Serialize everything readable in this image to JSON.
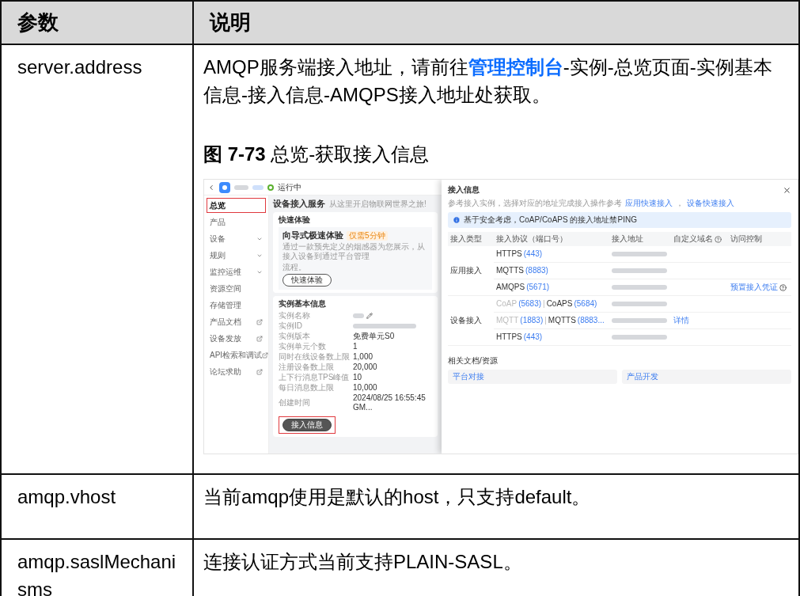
{
  "table": {
    "columns": [
      "参数",
      "说明"
    ],
    "rows": [
      {
        "param": "server.address",
        "description": {
          "before": "AMQP服务端接入地址，请前往",
          "link": "管理控制台",
          "after": "-实例-总览页面-实例基本信息-接入信息-AMQPS接入地址处获取。"
        },
        "figure": {
          "caption": "**图 7-73** 总览-获取接入信息",
          "screenshot": {
            "status": "运行中",
            "sidebar": [
              {
                "label": "总览",
                "kind": "plain",
                "selected": true
              },
              {
                "label": "产品",
                "kind": "plain",
                "selected": false
              },
              {
                "label": "设备",
                "kind": "expandable",
                "selected": false
              },
              {
                "label": "规则",
                "kind": "expandable",
                "selected": false
              },
              {
                "label": "监控运维",
                "kind": "expandable",
                "selected": false
              },
              {
                "label": "资源空间",
                "kind": "plain",
                "selected": false
              },
              {
                "label": "存储管理",
                "kind": "plain",
                "selected": false
              },
              {
                "label": "产品文档",
                "kind": "external",
                "selected": false
              },
              {
                "label": "设备发放",
                "kind": "external",
                "selected": false
              },
              {
                "label": "API检索和调试",
                "kind": "external",
                "selected": false
              },
              {
                "label": "论坛求助",
                "kind": "external",
                "selected": false
              }
            ],
            "service": {
              "title": "设备接入服务",
              "subtitle": "从这里开启物联网世界之旅!"
            },
            "quick": {
              "title": "快速体验",
              "heading": "向导式极速体验",
              "badge": "仅需5分钟",
              "description": "通过一款预先定义的烟感器为您展示，从接入设备到通过平台管理",
              "description_end": "流程。",
              "button": "快速体验"
            },
            "instance": {
              "title": "实例基本信息",
              "fields": [
                {
                  "label": "实例名称",
                  "editable": true
                },
                {
                  "label": "实例ID"
                },
                {
                  "label": "实例版本",
                  "value": "免费单元S0"
                },
                {
                  "label": "实例单元个数",
                  "value": "1"
                },
                {
                  "label": "同时在线设备数上限",
                  "value": "1,000"
                },
                {
                  "label": "注册设备数上限",
                  "value": "20,000"
                },
                {
                  "label": "上下行消息TPS峰值",
                  "value": "10"
                },
                {
                  "label": "每日消息数上限",
                  "value": "10,000"
                },
                {
                  "label": "创建时间",
                  "value": "2024/08/25 16:55:45 GM..."
                }
              ],
              "button": "接入信息",
              "highlighted": true
            },
            "modal": {
              "title": "接入信息",
              "description": "参考接入实例，选择对应的地址完成接入操作参考",
              "links": [
                "应用快速接入",
                "设备快速接入"
              ],
              "link_separator": "，",
              "notice": "基于安全考虑，CoAP/CoAPS 的接入地址禁PING",
              "columns": [
                {
                  "label": "接入类型",
                  "help": false
                },
                {
                  "label": "接入协议（端口号）",
                  "help": false
                },
                {
                  "label": "接入地址",
                  "help": false
                },
                {
                  "label": "自定义域名",
                  "help": true
                },
                {
                  "label": "访问控制",
                  "help": false
                }
              ],
              "groups": [
                {
                  "type": "应用接入",
                  "rows": [
                    {
                      "protocols": [
                        {
                          "name": "HTTPS",
                          "port": "(443)",
                          "disabled": false
                        }
                      ]
                    },
                    {
                      "protocols": [
                        {
                          "name": "MQTTS",
                          "port": "(8883)",
                          "disabled": false
                        }
                      ]
                    },
                    {
                      "protocols": [
                        {
                          "name": "AMQPS",
                          "port": "(5671)",
                          "disabled": false
                        }
                      ],
                      "action": {
                        "text": "预置接入凭证",
                        "help": true
                      }
                    }
                  ]
                },
                {
                  "type": "设备接入",
                  "rows": [
                    {
                      "protocols": [
                        {
                          "name": "CoAP",
                          "port": "(5683)",
                          "disabled": true
                        },
                        {
                          "name": "CoAPS",
                          "port": "(5684)",
                          "disabled": false
                        }
                      ],
                      "separator": "|"
                    },
                    {
                      "protocols": [
                        {
                          "name": "MQTT",
                          "port": "(1883)",
                          "disabled": true
                        },
                        {
                          "name": "MQTTS",
                          "port": "(8883...",
                          "disabled": false
                        }
                      ],
                      "separator": "|",
                      "domain_link": "详情"
                    },
                    {
                      "protocols": [
                        {
                          "name": "HTTPS",
                          "port": "(443)",
                          "disabled": false
                        }
                      ]
                    }
                  ]
                }
              ],
              "docs_title": "相关文档/资源",
              "docs": [
                "平台对接",
                "产品开发"
              ]
            }
          }
        }
      },
      {
        "param": "amqp.vhost",
        "description": {
          "before": "当前amqp使用是默认的host，只支持default。"
        }
      },
      {
        "param": "amqp.saslMechanisms",
        "description": {
          "before": "连接认证方式当前支持PLAIN-SASL。"
        }
      }
    ]
  }
}
